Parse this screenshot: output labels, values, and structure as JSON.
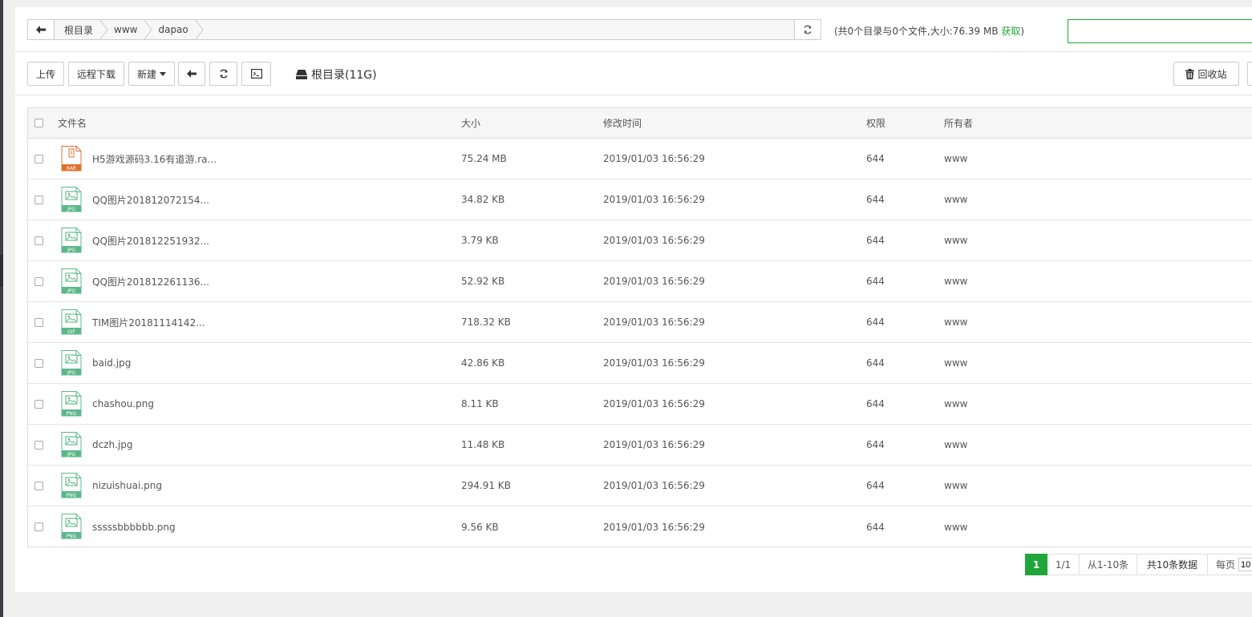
{
  "breadcrumb": {
    "items": [
      "根目录",
      "www",
      "dapao"
    ]
  },
  "info": {
    "text": "(共0个目录与0个文件,大小:76.39 MB ",
    "fetch_label": "获取",
    "close": ")"
  },
  "search": {
    "value": ""
  },
  "toolbar": {
    "upload_label": "上传",
    "remote_download_label": "远程下载",
    "new_label": "新建",
    "disk_label": "根目录(11G)",
    "recycle_label": "回收站"
  },
  "table": {
    "headers": {
      "name": "文件名",
      "size": "大小",
      "mtime": "修改时间",
      "perm": "权限",
      "owner": "所有者"
    },
    "rows": [
      {
        "name": "H5游戏源码3.16有道游.ra...",
        "type": "RAR",
        "size": "75.24 MB",
        "mtime": "2019/01/03 16:56:29",
        "perm": "644",
        "owner": "www"
      },
      {
        "name": "QQ图片201812072154...",
        "type": "JPG",
        "size": "34.82 KB",
        "mtime": "2019/01/03 16:56:29",
        "perm": "644",
        "owner": "www"
      },
      {
        "name": "QQ图片201812251932...",
        "type": "JPG",
        "size": "3.79 KB",
        "mtime": "2019/01/03 16:56:29",
        "perm": "644",
        "owner": "www"
      },
      {
        "name": "QQ图片201812261136...",
        "type": "JPG",
        "size": "52.92 KB",
        "mtime": "2019/01/03 16:56:29",
        "perm": "644",
        "owner": "www"
      },
      {
        "name": "TIM图片20181114142...",
        "type": "GIF",
        "size": "718.32 KB",
        "mtime": "2019/01/03 16:56:29",
        "perm": "644",
        "owner": "www"
      },
      {
        "name": "baid.jpg",
        "type": "JPG",
        "size": "42.86 KB",
        "mtime": "2019/01/03 16:56:29",
        "perm": "644",
        "owner": "www"
      },
      {
        "name": "chashou.png",
        "type": "PNG",
        "size": "8.11 KB",
        "mtime": "2019/01/03 16:56:29",
        "perm": "644",
        "owner": "www"
      },
      {
        "name": "dczh.jpg",
        "type": "JPG",
        "size": "11.48 KB",
        "mtime": "2019/01/03 16:56:29",
        "perm": "644",
        "owner": "www"
      },
      {
        "name": "nizuishuai.png",
        "type": "PNG",
        "size": "294.91 KB",
        "mtime": "2019/01/03 16:56:29",
        "perm": "644",
        "owner": "www"
      },
      {
        "name": "sssssbbbbbb.png",
        "type": "PNG",
        "size": "9.56 KB",
        "mtime": "2019/01/03 16:56:29",
        "perm": "644",
        "owner": "www"
      }
    ]
  },
  "pagination": {
    "current": "1",
    "pages": "1/1",
    "range": "从1-10条",
    "total": "共10条数据",
    "per_page_label": "每页",
    "per_page_value": "10"
  },
  "colors": {
    "accent": "#20a53a",
    "rar": "#e0712c",
    "image": "#5cb88a"
  }
}
